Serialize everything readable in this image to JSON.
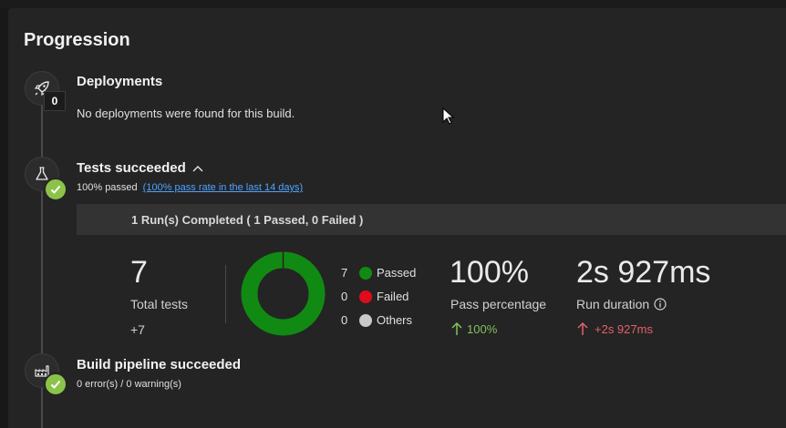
{
  "page_title": "Progression",
  "deployments": {
    "title": "Deployments",
    "count": "0",
    "message": "No deployments were found for this build."
  },
  "tests": {
    "title": "Tests succeeded",
    "passed_text": "100% passed",
    "pass_rate_link": "(100% pass rate in the last 14 days)",
    "run_summary": "1 Run(s) Completed ( 1 Passed, 0 Failed )",
    "total_tests_value": "7",
    "total_tests_label": "Total tests",
    "total_tests_delta": "+7",
    "legend": [
      {
        "count": "7",
        "label": "Passed",
        "color": "#118a13"
      },
      {
        "count": "0",
        "label": "Failed",
        "color": "#e00b1c"
      },
      {
        "count": "0",
        "label": "Others",
        "color": "#c8c8c8"
      }
    ],
    "donut": {
      "passed": 7,
      "failed": 0,
      "others": 0
    },
    "pass_percentage_value": "100%",
    "pass_percentage_label": "Pass percentage",
    "pass_percentage_delta": "100%",
    "run_duration_value": "2s 927ms",
    "run_duration_label": "Run duration",
    "run_duration_delta": "+2s 927ms"
  },
  "build": {
    "title": "Build pipeline succeeded",
    "status": "0 error(s) / 0 warning(s)"
  },
  "colors": {
    "accent_link": "#4fa3ff",
    "success": "#8bc34a",
    "delta_up_good": "#7dc35b",
    "delta_up_bad": "#e5616b"
  }
}
